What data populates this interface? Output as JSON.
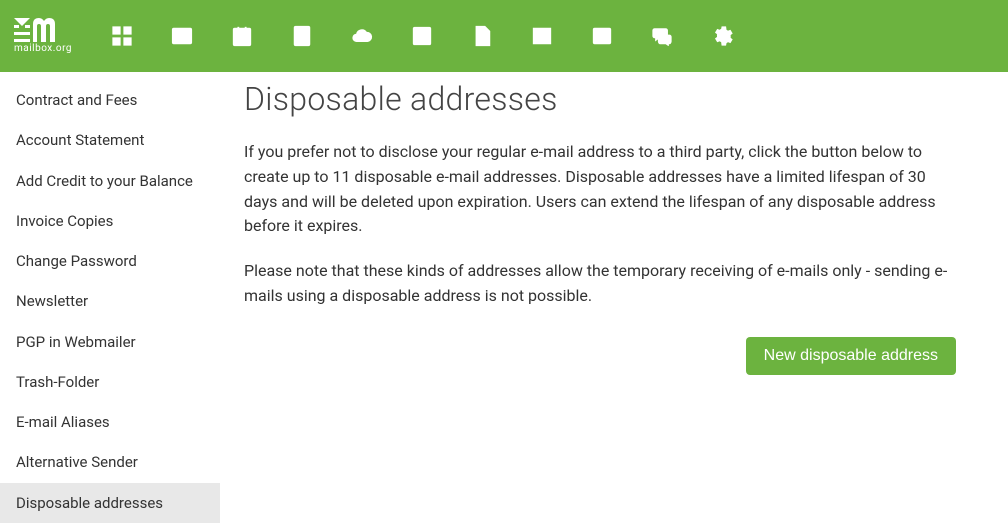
{
  "brand": {
    "name": "mailbox.org"
  },
  "nav": {
    "items": [
      {
        "id": "dashboard"
      },
      {
        "id": "mail"
      },
      {
        "id": "calendar"
      },
      {
        "id": "contacts"
      },
      {
        "id": "cloud"
      },
      {
        "id": "tasks"
      },
      {
        "id": "documents"
      },
      {
        "id": "spreadsheet"
      },
      {
        "id": "news"
      },
      {
        "id": "chat"
      },
      {
        "id": "settings"
      }
    ]
  },
  "sidebar": {
    "items": [
      {
        "label": "Contract and Fees",
        "active": false
      },
      {
        "label": "Account Statement",
        "active": false
      },
      {
        "label": "Add Credit to your Balance",
        "active": false
      },
      {
        "label": "Invoice Copies",
        "active": false
      },
      {
        "label": "Change Password",
        "active": false
      },
      {
        "label": "Newsletter",
        "active": false
      },
      {
        "label": "PGP in Webmailer",
        "active": false
      },
      {
        "label": "Trash-Folder",
        "active": false
      },
      {
        "label": "E-mail Aliases",
        "active": false
      },
      {
        "label": "Alternative Sender",
        "active": false
      },
      {
        "label": "Disposable addresses",
        "active": true
      }
    ]
  },
  "content": {
    "title": "Disposable addresses",
    "paragraph1": "If you prefer not to disclose your regular e-mail address to a third party, click the button below to create up to 11 disposable e-mail addresses. Disposable addresses have a limited lifespan of 30 days and will be deleted upon expiration. Users can extend the lifespan of any disposable address before it expires.",
    "paragraph2": "Please note that these kinds of addresses allow the temporary receiving of e-mails only - sending e-mails using a disposable address is not possible.",
    "button_label": "New disposable address"
  },
  "colors": {
    "accent": "#6cb33f"
  }
}
